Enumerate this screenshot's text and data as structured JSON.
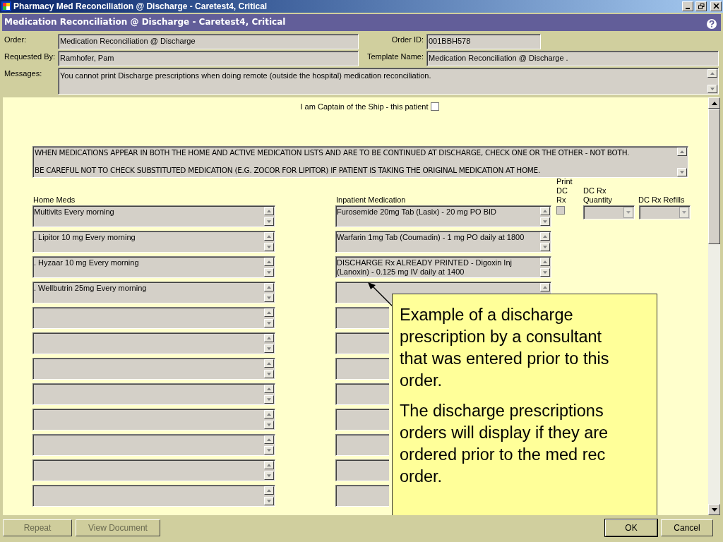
{
  "window": {
    "title": "Pharmacy Med Reconciliation @ Discharge - Caretest4, Critical"
  },
  "header": {
    "title": "Medication Reconciliation @ Discharge - Caretest4, Critical"
  },
  "fields": {
    "order_label": "Order:",
    "order": "Medication Reconciliation @ Discharge",
    "order_id_label": "Order ID:",
    "order_id": "001BBH578",
    "requested_by_label": "Requested By:",
    "requested_by": "Ramhofer, Pam",
    "template_label": "Template Name:",
    "template": "Medication Reconciliation @ Discharge .",
    "messages_label": "Messages:",
    "messages": "You cannot print Discharge prescriptions when doing remote (outside the hospital) medication reconciliation."
  },
  "captain": {
    "label": "I am Captain of the Ship - this patient",
    "checked": false
  },
  "notice": [
    "WHEN MEDICATIONS APPEAR IN BOTH THE HOME AND ACTIVE MEDICATION LISTS AND ARE TO BE CONTINUED AT DISCHARGE, CHECK ONE OR THE OTHER - NOT BOTH.",
    "BE CAREFUL NOT TO CHECK SUBSTITUTED MEDICATION (E.G. ZOCOR FOR LIPITOR) IF PATIENT IS TAKING THE ORIGINAL MEDICATION AT HOME."
  ],
  "columns": {
    "home": "Home Meds",
    "inpatient": "Inpatient Medication",
    "print": [
      "Print",
      "DC",
      "Rx"
    ],
    "quantity": [
      "DC Rx",
      "Quantity"
    ],
    "refills": "DC Rx Refills"
  },
  "rows": [
    {
      "home": "Multivits Every morning",
      "inpatient": "Furosemide   20mg Tab (Lasix) - 20 mg PO BID",
      "print_dc_rx": false
    },
    {
      "home": ". Lipitor 10 mg Every morning",
      "inpatient": "Warfarin  1mg Tab (Coumadin) - 1 mg PO daily at 1800"
    },
    {
      "home": ". Hyzaar 10 mg Every morning",
      "inpatient": "DISCHARGE Rx ALREADY PRINTED - Digoxin  Inj (Lanoxin) - 0.125 mg IV daily at 1400"
    },
    {
      "home": ". Wellbutrin 25mg Every morning"
    },
    {},
    {},
    {},
    {},
    {},
    {},
    {},
    {}
  ],
  "callout": [
    "Example of a discharge prescription by a consultant that was entered prior to this order.",
    "The discharge prescriptions orders will display if they are ordered prior to the med rec order."
  ],
  "buttons_left": [
    "Repeat",
    "View Document"
  ],
  "buttons_right": [
    "OK",
    "Cancel"
  ]
}
